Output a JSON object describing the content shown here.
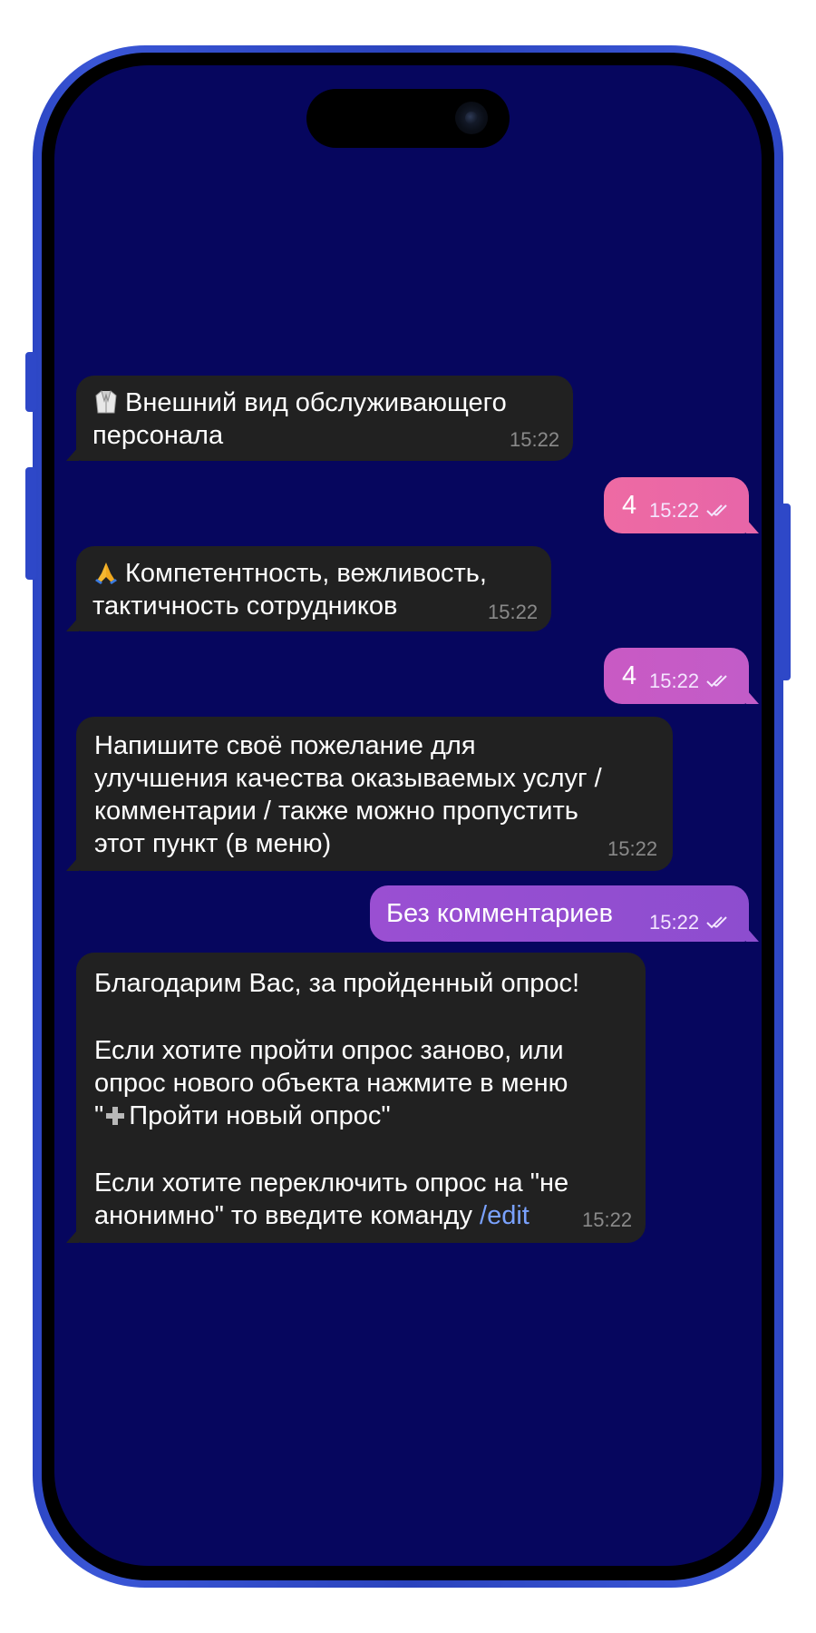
{
  "chat": {
    "messages": [
      {
        "direction": "incoming",
        "icon": "coat-icon",
        "text": "Внешний вид обслуживающего",
        "text2": "персонала",
        "time": "15:22"
      },
      {
        "direction": "outgoing",
        "text": "4",
        "time": "15:22",
        "status": "read"
      },
      {
        "direction": "incoming",
        "icon": "folded-hands-icon",
        "text": "Компетентность, вежливость,",
        "text2": "тактичность сотрудников",
        "time": "15:22"
      },
      {
        "direction": "outgoing",
        "text": "4",
        "time": "15:22",
        "status": "read"
      },
      {
        "direction": "incoming",
        "lines": [
          "Напишите своё пожелание для",
          "улучшения качества оказываемых услуг /",
          "комментарии / также можно пропустить",
          "этот пункт (в меню)"
        ],
        "time": "15:22"
      },
      {
        "direction": "outgoing",
        "text": "Без комментариев",
        "time": "15:22",
        "status": "read"
      },
      {
        "direction": "incoming",
        "lines": [
          "Благодарим Вас, за пройденный опрос!",
          "Если хотите пройти опрос заново, или",
          "опрос нового объекта нажмите в меню",
          "\"",
          "Пройти новый опрос\"",
          "Если хотите переключить опрос на \"не",
          "анонимно\" то введите команду ",
          "/edit"
        ],
        "time": "15:22"
      }
    ]
  },
  "colors": {
    "screen_bg": "#06065e",
    "incoming_bubble": "#212121",
    "outgoing_gradient": [
      "#e968a6",
      "#c35cc8",
      "#8f4dcf"
    ],
    "link": "#7aa2ff",
    "phone_frame": "#2e48c8"
  }
}
